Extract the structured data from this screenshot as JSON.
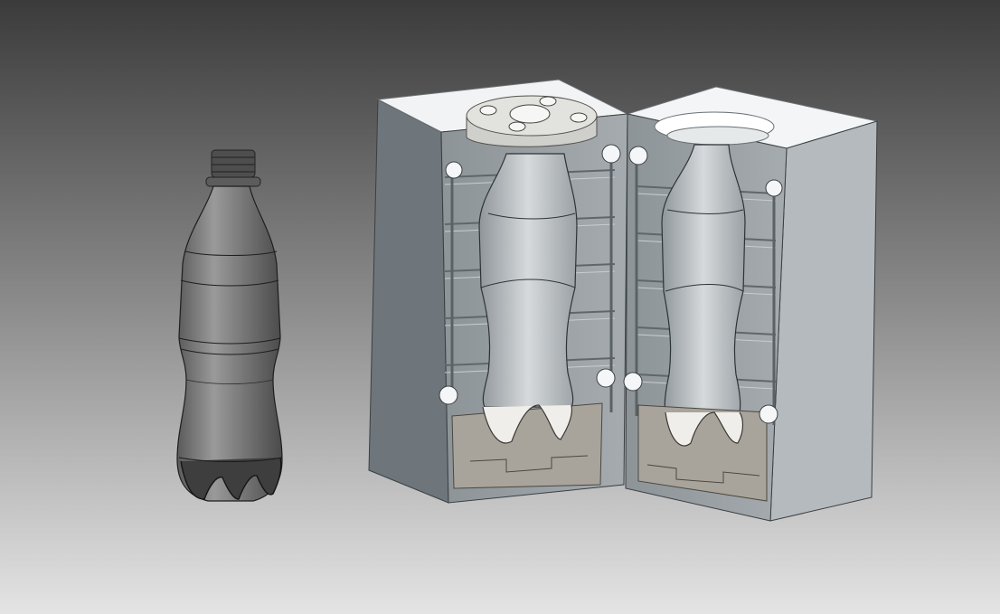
{
  "scene": {
    "background_top": "#3b3b3b",
    "background_bottom": "#e4e4e4",
    "bottle_color": "#7a7a7a",
    "mold_face_color": "#9aa1a5",
    "mold_side_color": "#6f777c",
    "mold_top_color": "#f3f5f6",
    "cavity_color": "#b9bec1",
    "base_insert_color": "#a8a39a",
    "flange_color": "#d9d9d6",
    "channel_color": "#8a9297"
  },
  "objects": [
    {
      "name": "pet-bottle",
      "kind": "preview"
    },
    {
      "name": "mold-half-left",
      "kind": "open"
    },
    {
      "name": "mold-half-right",
      "kind": "open"
    },
    {
      "name": "neck-flange-plate",
      "kind": "open"
    },
    {
      "name": "base-insert",
      "kind": "open"
    }
  ]
}
